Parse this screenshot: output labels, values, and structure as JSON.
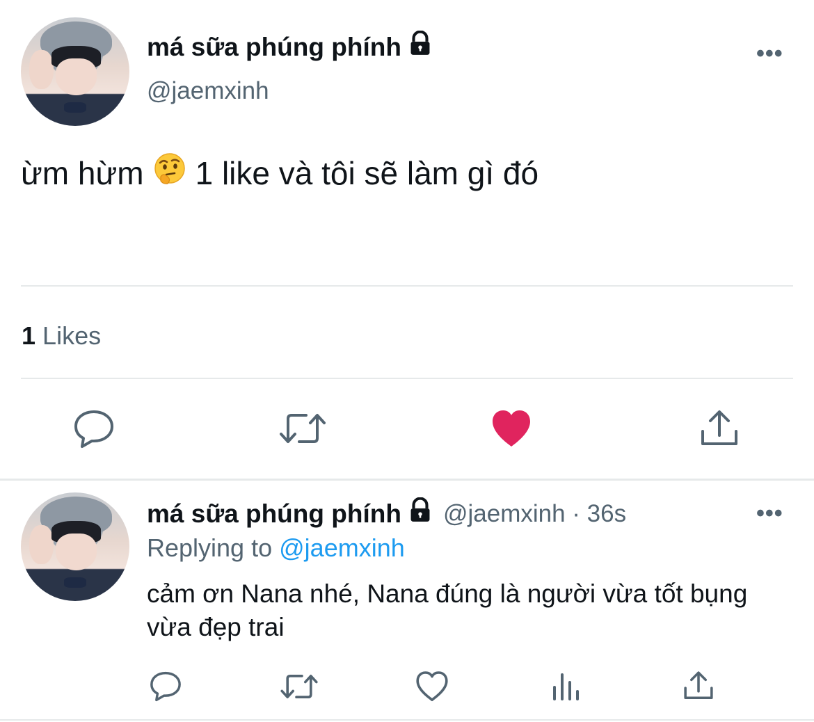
{
  "tweet": {
    "display_name": "má sữa phúng phính",
    "handle": "@jaemxinh",
    "text_before_emoji": "ừm hừm",
    "emoji": "thinking-face",
    "text_after_emoji": "1 like và tôi sẽ làm gì đó",
    "likes_count": "1",
    "likes_label": "Likes",
    "liked": true,
    "more_label": "•••"
  },
  "reply": {
    "display_name": "má sữa phúng phính",
    "handle_time": "@jaemxinh · 36s",
    "replying_to_label": "Replying to",
    "replying_to_handle": "@jaemxinh",
    "text": "cảm ơn Nana nhé, Nana đúng là người vừa tốt bụng vừa đẹp trai",
    "more_label": "•••"
  },
  "colors": {
    "like_active": "#e0245e",
    "link": "#1d9bf0",
    "secondary_text": "#536471",
    "divider": "#e6e9ea"
  },
  "icons": {
    "main_actions": [
      "reply-icon",
      "retweet-icon",
      "like-icon-filled",
      "share-icon"
    ],
    "reply_actions": [
      "reply-icon",
      "retweet-icon",
      "like-icon",
      "analytics-icon",
      "share-icon"
    ]
  }
}
